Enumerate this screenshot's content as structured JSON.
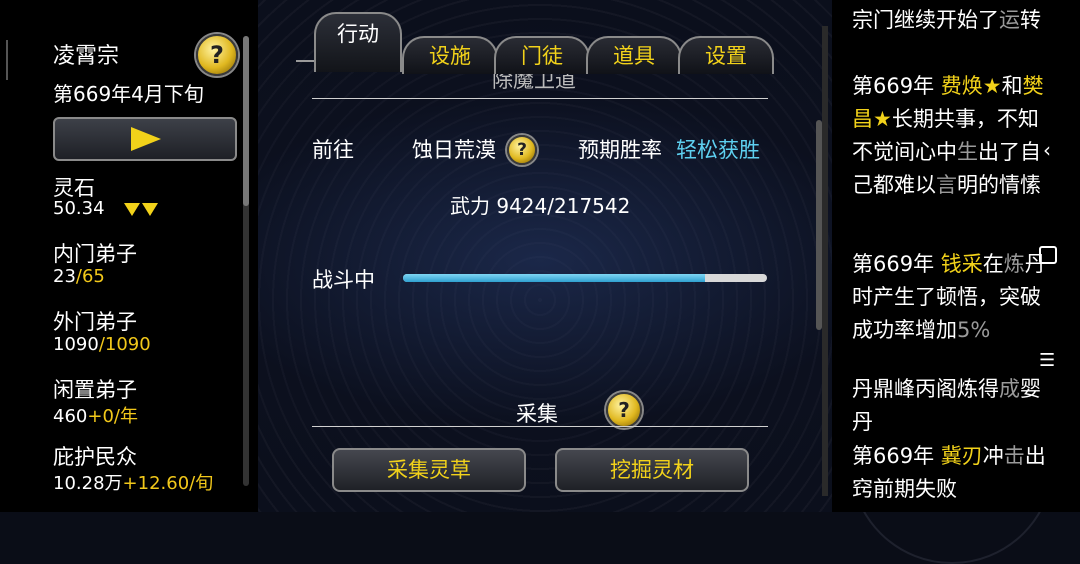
{
  "left": {
    "sect_name": "凌霄宗",
    "date": "第669年4月下旬",
    "resources": [
      {
        "label": "灵石",
        "value": "50.34"
      },
      {
        "label": "内门弟子",
        "value": "23",
        "value_extra": "/65"
      },
      {
        "label": "外门弟子",
        "value": "1090",
        "value_extra": "/1090"
      },
      {
        "label": "闲置弟子",
        "value": "460",
        "value_extra": "+0/年"
      },
      {
        "label": "庇护民众",
        "value": "10.28万",
        "value_extra": "+12.60/旬"
      }
    ]
  },
  "tabs": [
    "行动",
    "设施",
    "门徒",
    "道具",
    "设置"
  ],
  "mission": {
    "header_partial": "除魔卫道",
    "go_label": "前往",
    "destination": "蚀日荒漠",
    "expect_label": "预期胜率",
    "expect_value": "轻松获胜",
    "power_label": "武力",
    "power_value": "9424/217542",
    "battle_label": "战斗中",
    "progress_fraction": 0.83
  },
  "gather": {
    "title": "采集",
    "buttons": [
      "采集灵草",
      "挖掘灵材"
    ]
  },
  "log": [
    {
      "parts": [
        {
          "t": "宗门继续开始了",
          "c": "w"
        },
        {
          "t": "运",
          "c": "g"
        },
        {
          "t": "转",
          "c": "w"
        }
      ]
    },
    {
      "parts": [
        {
          "t": "第669年 ",
          "c": "w"
        },
        {
          "t": "费焕★",
          "c": "y"
        },
        {
          "t": "和",
          "c": "w"
        },
        {
          "t": "樊昌★",
          "c": "y"
        },
        {
          "t": "长期共事，不知不觉间心中",
          "c": "w"
        },
        {
          "t": "生",
          "c": "g"
        },
        {
          "t": "出了自己都难以",
          "c": "w"
        },
        {
          "t": "言",
          "c": "g"
        },
        {
          "t": "明的情愫",
          "c": "w"
        }
      ]
    },
    {
      "parts": [
        {
          "t": "第669年 ",
          "c": "w"
        },
        {
          "t": "钱采",
          "c": "y"
        },
        {
          "t": "在",
          "c": "w"
        },
        {
          "t": "炼",
          "c": "g"
        },
        {
          "t": "丹时产生了顿悟，突破成功率增加",
          "c": "w"
        },
        {
          "t": "5%",
          "c": "g"
        }
      ]
    },
    {
      "parts": [
        {
          "t": "丹鼎峰丙阁炼得",
          "c": "w"
        },
        {
          "t": "成",
          "c": "g"
        },
        {
          "t": "婴丹",
          "c": "w"
        }
      ]
    },
    {
      "parts": [
        {
          "t": "第669年 ",
          "c": "w"
        },
        {
          "t": "冀刃",
          "c": "y"
        },
        {
          "t": "冲",
          "c": "w"
        },
        {
          "t": "击",
          "c": "g"
        },
        {
          "t": "出窍前期失败",
          "c": "w"
        }
      ]
    }
  ],
  "colors": {
    "accent": "#f2d21a",
    "cyan": "#5ed0f0",
    "progress": "#2fa0d0"
  }
}
